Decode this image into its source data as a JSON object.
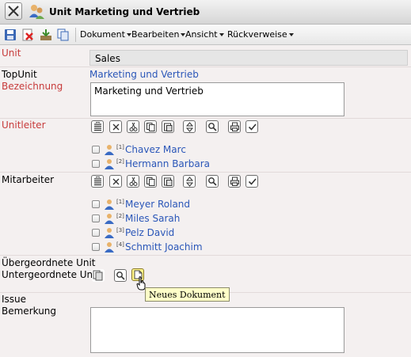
{
  "window": {
    "title": "Unit Marketing und Vertrieb"
  },
  "toolbar": {
    "menus": [
      "Dokument",
      "Bearbeiten",
      "Ansicht",
      "Rückverweise"
    ]
  },
  "form": {
    "unit": {
      "label": "Unit",
      "value": "Sales"
    },
    "topunit": {
      "label": "TopUnit",
      "value": "Marketing und Vertrieb"
    },
    "bezeichnung": {
      "label": "Bezeichnung",
      "value": "Marketing und Vertrieb"
    },
    "unitleiter": {
      "label": "Unitleiter",
      "entries": [
        {
          "index": "[1]",
          "name": "Chavez Marc"
        },
        {
          "index": "[2]",
          "name": "Hermann Barbara"
        }
      ]
    },
    "mitarbeiter": {
      "label": "Mitarbeiter",
      "entries": [
        {
          "index": "[1]",
          "name": "Meyer Roland"
        },
        {
          "index": "[2]",
          "name": "Miles Sarah"
        },
        {
          "index": "[3]",
          "name": "Pelz David"
        },
        {
          "index": "[4]",
          "name": "Schmitt Joachim"
        }
      ]
    },
    "uebergeordnete": {
      "label": "Übergeordnete Unit"
    },
    "untergeordnete": {
      "label": "Untergeordnete Unit"
    },
    "issue": {
      "label": "Issue"
    },
    "bemerkung": {
      "label": "Bemerkung",
      "value": ""
    }
  },
  "tooltip": {
    "text": "Neues Dokument"
  },
  "colors": {
    "required_label": "#c73a3a",
    "link": "#2a56b8",
    "tooltip_bg": "#ffffc8"
  }
}
